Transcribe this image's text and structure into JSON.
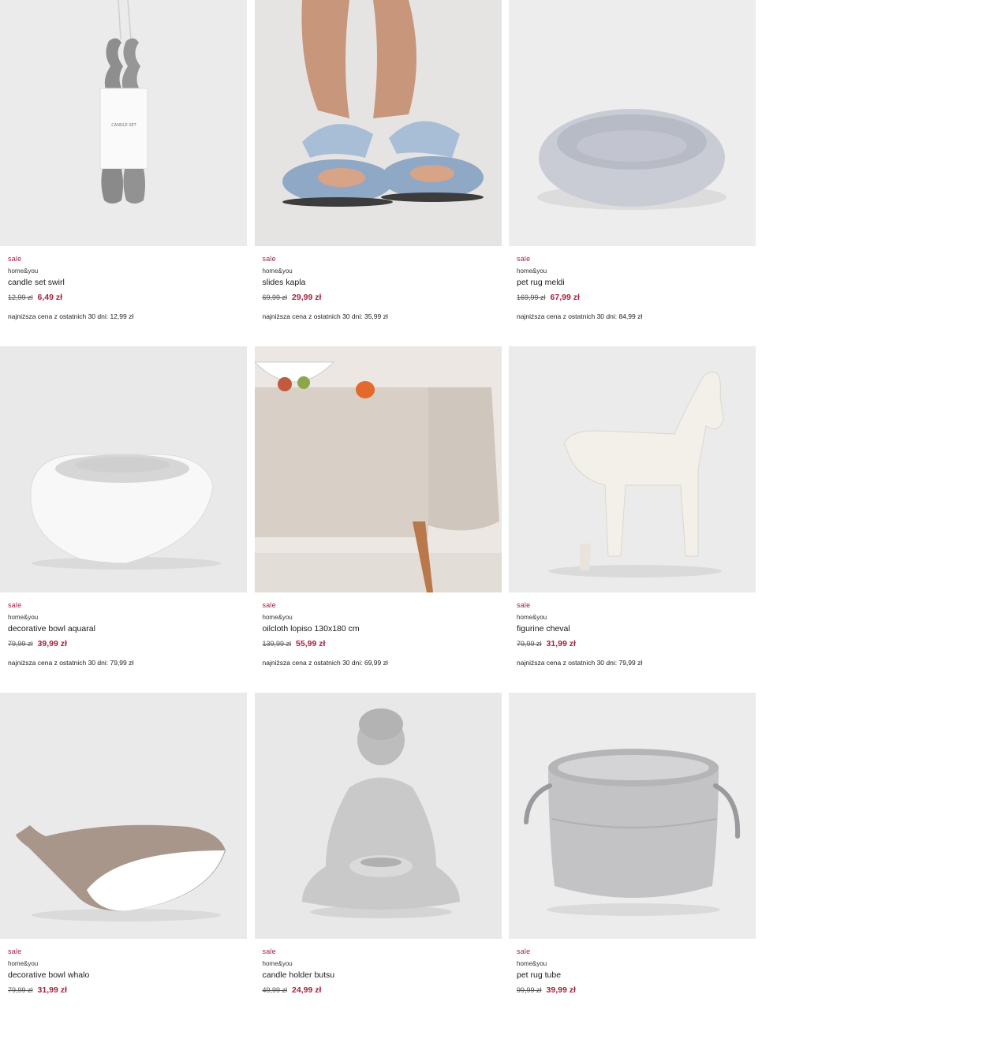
{
  "products": [
    {
      "sale": "sale",
      "brand": "home&you",
      "name": "candle set swirl",
      "old_price": "12,99 zł",
      "price": "6,49 zł",
      "lowest": "najniższa cena z ostatnich 30 dni: 12,99 zł",
      "candle_box_text": "CANDLE SET"
    },
    {
      "sale": "sale",
      "brand": "home&you",
      "name": "slides kapla",
      "old_price": "69,99 zł",
      "price": "29,99 zł",
      "lowest": "najniższa cena z ostatnich 30 dni: 35,99 zł"
    },
    {
      "sale": "sale",
      "brand": "home&you",
      "name": "pet rug meldi",
      "old_price": "169,99 zł",
      "price": "67,99 zł",
      "lowest": "najniższa cena z ostatnich 30 dni: 84,99 zł"
    },
    {
      "sale": "sale",
      "brand": "home&you",
      "name": "decorative bowl aquaral",
      "old_price": "79,99 zł",
      "price": "39,99 zł",
      "lowest": "najniższa cena z ostatnich 30 dni: 79,99 zł"
    },
    {
      "sale": "sale",
      "brand": "home&you",
      "name": "oilcloth lopiso 130x180 cm",
      "old_price": "139,99 zł",
      "price": "55,99 zł",
      "lowest": "najniższa cena z ostatnich 30 dni: 69,99 zł"
    },
    {
      "sale": "sale",
      "brand": "home&you",
      "name": "figurine cheval",
      "old_price": "79,99 zł",
      "price": "31,99 zł",
      "lowest": "najniższa cena z ostatnich 30 dni: 79,99 zł"
    },
    {
      "sale": "sale",
      "brand": "home&you",
      "name": "decorative bowl whalo",
      "old_price": "79,99 zł",
      "price": "31,99 zł",
      "lowest": ""
    },
    {
      "sale": "sale",
      "brand": "home&you",
      "name": "candle holder butsu",
      "old_price": "49,99 zł",
      "price": "24,99 zł",
      "lowest": ""
    },
    {
      "sale": "sale",
      "brand": "home&you",
      "name": "pet rug tube",
      "old_price": "99,99 zł",
      "price": "39,99 zł",
      "lowest": ""
    }
  ],
  "colors": {
    "sale_accent": "#a2223f",
    "image_background": "#ececec"
  }
}
